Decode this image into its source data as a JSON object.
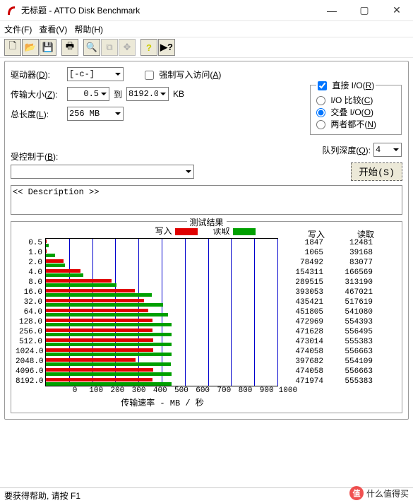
{
  "window": {
    "title": "无标题 - ATTO Disk Benchmark"
  },
  "menu": {
    "file": "文件(F)",
    "view": "查看(V)",
    "help": "帮助(H)"
  },
  "toolbar_icons": [
    "new",
    "open",
    "save",
    "print",
    "find",
    "copy",
    "move",
    "about",
    "whatsthis"
  ],
  "form": {
    "drive_label_a": "驱动器(",
    "drive_label_u": "D",
    "drive_label_b": "):",
    "drive_value": "[-c-]",
    "size_label_a": "传输大小(",
    "size_label_u": "Z",
    "size_label_b": "):",
    "size_from": "0.5",
    "size_to_label": "到",
    "size_to": "8192.0",
    "size_unit": "KB",
    "len_label_a": "总长度(",
    "len_label_u": "L",
    "len_label_b": "):",
    "len_value": "256 MB",
    "force_label_a": "强制写入访问(",
    "force_label_u": "A",
    "force_label_b": ")",
    "direct_label_a": "直接 I/O(",
    "direct_label_u": "R",
    "direct_label_b": ")",
    "opt1_a": "I/O 比较(",
    "opt1_u": "C",
    "opt1_b": ")",
    "opt2_a": "交叠 I/O(",
    "opt2_u": "O",
    "opt2_b": ")",
    "opt3_a": "两者都不(",
    "opt3_u": "N",
    "opt3_b": ")",
    "qd_label_a": "队列深度(",
    "qd_label_u": "Q",
    "qd_label_b": "):",
    "qd_value": "4",
    "ctrl_label_a": "受控制于(",
    "ctrl_label_u": "B",
    "ctrl_label_b": "):",
    "ctrl_value": "",
    "start_label": "开始(S)",
    "desc": "<< Description >>"
  },
  "chart_data": {
    "type": "bar",
    "title": "测试结果",
    "xlabel": "传输速率 - MB / 秒",
    "ylabel": "",
    "xlim": [
      0,
      1000
    ],
    "xticks": [
      0,
      100,
      200,
      300,
      400,
      500,
      600,
      700,
      800,
      900,
      1000
    ],
    "categories": [
      "0.5",
      "1.0",
      "2.0",
      "4.0",
      "8.0",
      "16.0",
      "32.0",
      "64.0",
      "128.0",
      "256.0",
      "512.0",
      "1024.0",
      "2048.0",
      "4096.0",
      "8192.0"
    ],
    "series": [
      {
        "name": "写入",
        "color": "#e00000",
        "values": [
          1847,
          1065,
          78492,
          154311,
          289515,
          393053,
          435421,
          451805,
          472969,
          471628,
          473014,
          474058,
          397682,
          474058,
          471974
        ]
      },
      {
        "name": "读取",
        "color": "#00a000",
        "values": [
          12481,
          39168,
          83077,
          166569,
          313190,
          467021,
          517619,
          541080,
          554393,
          556495,
          555383,
          556663,
          554109,
          556663,
          555383
        ]
      }
    ],
    "value_headers": [
      "写入",
      "读取"
    ]
  },
  "status": {
    "text": "要获得帮助, 请按 F1"
  },
  "watermark": {
    "text": "什么值得买"
  }
}
